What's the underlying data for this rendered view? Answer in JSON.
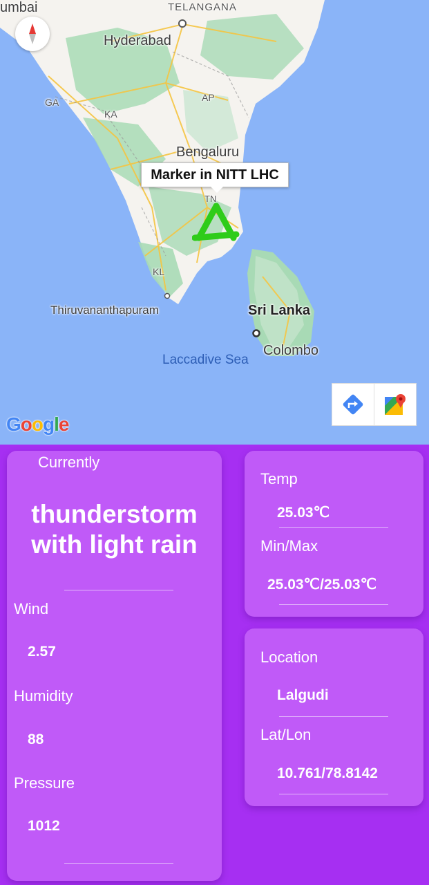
{
  "map": {
    "places": {
      "mumbai": "umbai",
      "telangana": "TELANGANA",
      "hyderabad": "Hyderabad",
      "ga": "GA",
      "ap": "AP",
      "ka": "KA",
      "bengaluru": "Bengaluru",
      "tn": "TN",
      "kl": "KL",
      "thiruvananthapuram": "Thiruvananthapuram",
      "sri_lanka": "Sri Lanka",
      "colombo": "Colombo",
      "laccadive_sea": "Laccadive Sea"
    },
    "marker_info": "Marker in NITT LHC",
    "google_logo": {
      "letters": [
        "G",
        "o",
        "o",
        "g",
        "l",
        "e"
      ],
      "colors": [
        "#4285F4",
        "#EA4335",
        "#FBBC05",
        "#4285F4",
        "#34A853",
        "#EA4335"
      ]
    },
    "colors": {
      "water": "#8ab4f8",
      "land": "#f5f3ef",
      "vegetation": "#a8dab5",
      "roads": "#f5c542",
      "marker": "#2ecc1a"
    }
  },
  "weather": {
    "currently_label": "Currently",
    "condition": "thunderstorm with light rain",
    "wind_label": "Wind",
    "wind": "2.57",
    "humidity_label": "Humidity",
    "humidity": "88",
    "pressure_label": "Pressure",
    "pressure": "1012",
    "temp_label": "Temp",
    "temp": "25.03℃",
    "minmax_label": "Min/Max",
    "minmax": "25.03℃/25.03℃",
    "location_label": "Location",
    "location": "Lalgudi",
    "latlon_label": "Lat/Lon",
    "latlon": "10.761/78.8142"
  },
  "colors": {
    "background": "#a62ff2",
    "card": "#c05af8"
  }
}
